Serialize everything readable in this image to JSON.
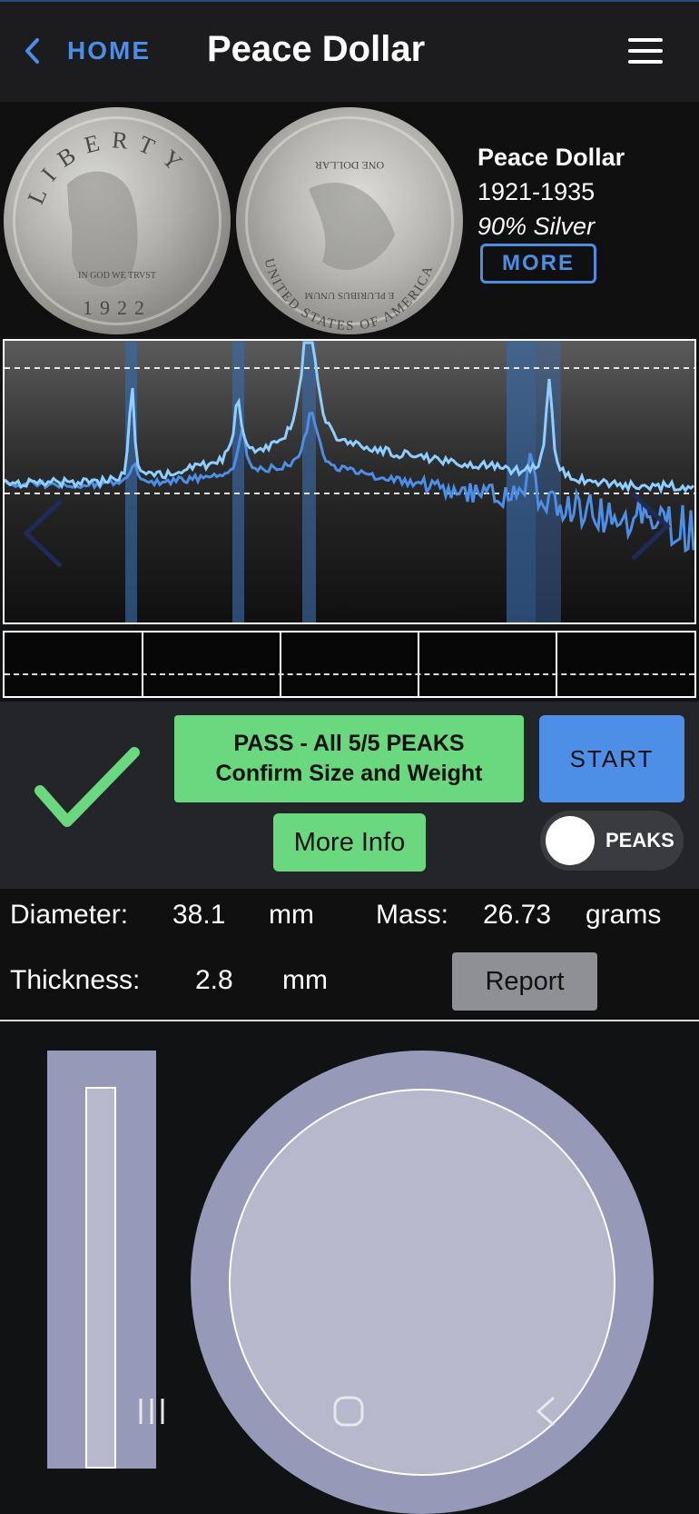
{
  "header": {
    "back_label": "HOME",
    "title": "Peace Dollar",
    "icons": {
      "back": "chevron-left-icon",
      "menu": "hamburger-menu-icon"
    }
  },
  "coin": {
    "name": "Peace Dollar",
    "years": "1921-1935",
    "composition": "90% Silver",
    "more_label": "MORE",
    "obverse_legend": "LIBERTY",
    "obverse_date": "1922",
    "obverse_motto": "IN GOD WE TRVST",
    "reverse_legend": "UNITED STATES OF AMERICA",
    "reverse_motto": "E PLURIBUS UNUM",
    "reverse_denomination": "ONE DOLLAR"
  },
  "spectrum": {
    "peak_bands": 5,
    "nav_icons": {
      "prev": "chevron-left-icon",
      "next": "chevron-right-icon"
    },
    "colors": {
      "trace_light": "#8fcfff",
      "trace_dark": "#4d8ee6",
      "band": "#3a6aa8"
    }
  },
  "result": {
    "status_line1": "PASS - All 5/5 PEAKS",
    "status_line2": "Confirm Size and Weight",
    "more_info_label": "More Info",
    "start_label": "START",
    "peaks_label": "PEAKS",
    "peaks_enabled": true,
    "status_icon": "checkmark-icon",
    "colors": {
      "pass": "#69d87e",
      "start": "#4d8ee6"
    }
  },
  "measurements": {
    "diameter_label": "Diameter:",
    "diameter_value": "38.1",
    "diameter_unit": "mm",
    "mass_label": "Mass:",
    "mass_value": "26.73",
    "mass_unit": "grams",
    "thickness_label": "Thickness:",
    "thickness_value": "2.8",
    "thickness_unit": "mm",
    "report_label": "Report"
  },
  "navbar": {
    "icons": [
      "recent-apps-icon",
      "home-icon",
      "back-icon"
    ]
  }
}
